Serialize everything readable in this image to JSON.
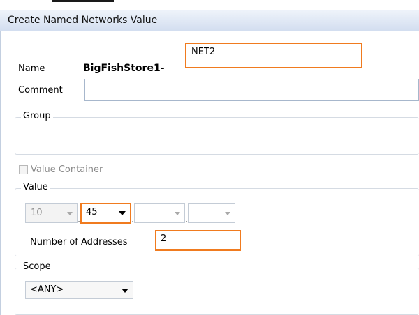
{
  "dialog": {
    "title": "Create Named Networks Value"
  },
  "name": {
    "label": "Name",
    "prefix": "BigFishStore1-",
    "value": "NET2"
  },
  "comment": {
    "label": "Comment",
    "value": ""
  },
  "group": {
    "legend": "Group"
  },
  "value_container": {
    "label": "Value Container",
    "checked": false
  },
  "value": {
    "legend": "Value",
    "octets": [
      "10",
      "45",
      "",
      ""
    ],
    "separator": ".",
    "num_addresses_label": "Number of Addresses",
    "num_addresses": "2"
  },
  "scope": {
    "legend": "Scope",
    "selected": "<ANY>"
  },
  "colors": {
    "highlight": "#f07b1f",
    "titlebar": "#d3def0"
  }
}
